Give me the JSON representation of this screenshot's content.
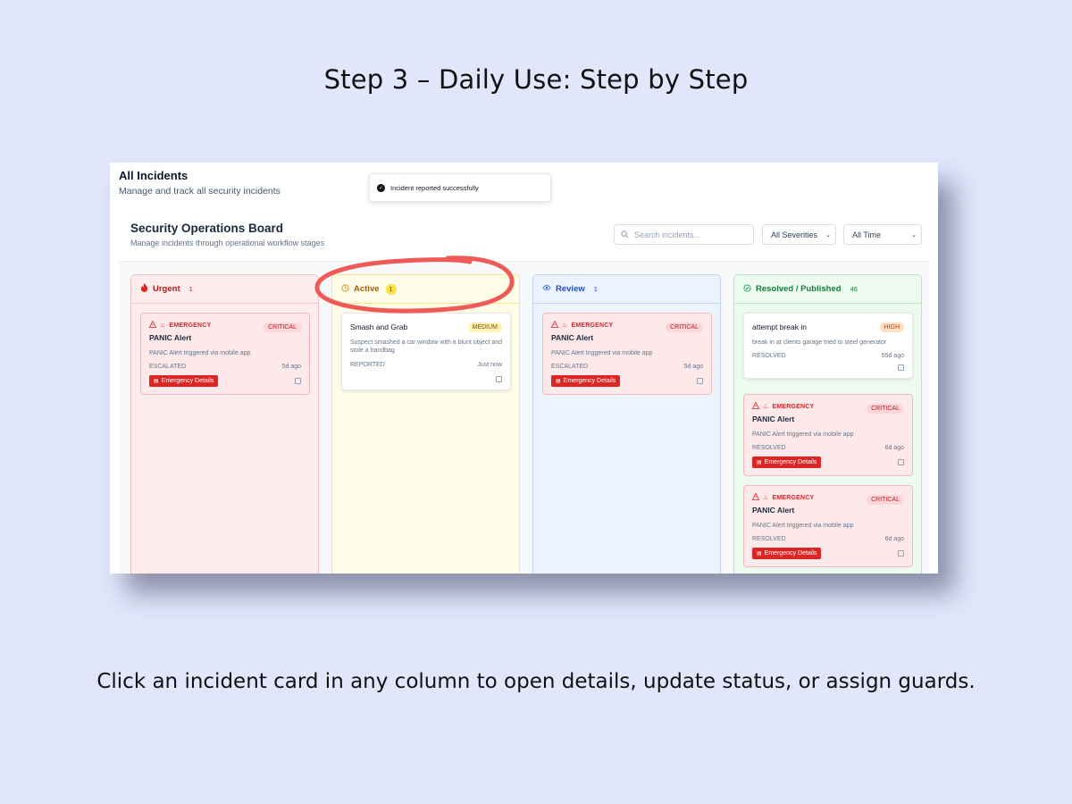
{
  "slide": {
    "title": "Step 3 – Daily Use: Step by Step",
    "caption": "Click an incident card in any column to open details, update status, or assign guards."
  },
  "page": {
    "title": "All Incidents",
    "subtitle": "Manage and track all security incidents"
  },
  "toast": {
    "message": "Incident reported successfully"
  },
  "board": {
    "title": "Security Operations Board",
    "subtitle": "Manage incidents through operational workflow stages",
    "search_placeholder": "Search incidents...",
    "severity_filter": "All Severities",
    "time_filter": "All Time"
  },
  "columns": {
    "urgent": {
      "label": "Urgent",
      "count": "1",
      "cards": [
        {
          "flag": "EMERGENCY",
          "title": "PANIC Alert",
          "severity": "CRITICAL",
          "desc": "PANIC Alert triggered via mobile app",
          "status": "ESCALATED",
          "age": "5d ago",
          "button": "Emergency Details"
        }
      ]
    },
    "active": {
      "label": "Active",
      "count": "1",
      "cards": [
        {
          "title": "Smash and Grab",
          "severity": "MEDIUM",
          "desc": "Suspect smashed a car window with a blunt object and stole a handbag",
          "status": "REPORTED",
          "age": "Just now"
        }
      ]
    },
    "review": {
      "label": "Review",
      "count": "1",
      "cards": [
        {
          "flag": "EMERGENCY",
          "title": "PANIC Alert",
          "severity": "CRITICAL",
          "desc": "PANIC Alert triggered via mobile app",
          "status": "ESCALATED",
          "age": "5d ago",
          "button": "Emergency Details"
        }
      ]
    },
    "resolved": {
      "label": "Resolved / Published",
      "count": "46",
      "cards": [
        {
          "title": "attempt break in",
          "severity": "HIGH",
          "desc": "break in at clients garage tried to steel generator",
          "status": "RESOLVED",
          "age": "55d ago"
        },
        {
          "flag": "EMERGENCY",
          "title": "PANIC Alert",
          "severity": "CRITICAL",
          "desc": "PANIC Alert triggered via mobile app",
          "status": "RESOLVED",
          "age": "6d ago",
          "button": "Emergency Details"
        },
        {
          "flag": "EMERGENCY",
          "title": "PANIC Alert",
          "severity": "CRITICAL",
          "desc": "PANIC Alert triggered via mobile app",
          "status": "RESOLVED",
          "age": "6d ago",
          "button": "Emergency Details"
        }
      ]
    }
  },
  "colors": {
    "annotation": "#ef5a56",
    "urgent": "#dc2626",
    "active": "#ca8a04",
    "review": "#2563eb",
    "resolved": "#16a34a"
  }
}
